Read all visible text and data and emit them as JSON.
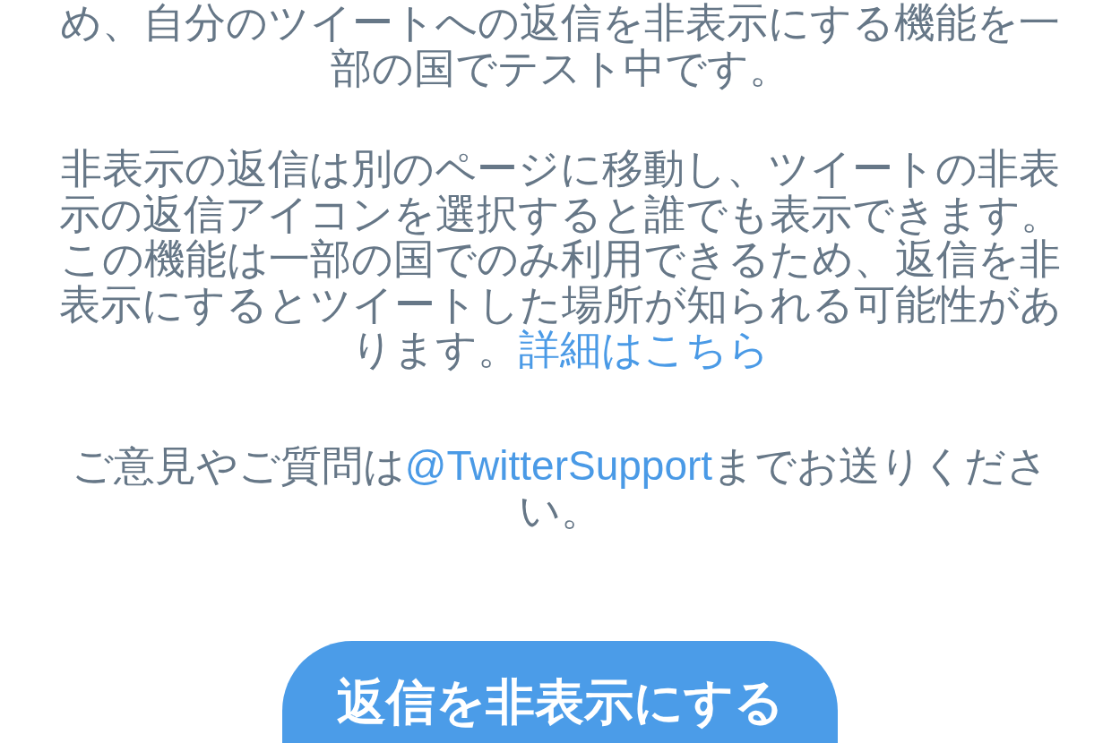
{
  "paragraphs": [
    {
      "parts": [
        {
          "kind": "text",
          "text": "め、自分のツイートへの返信を非表示にする機能を一部の国でテスト中です。"
        }
      ]
    },
    {
      "parts": [
        {
          "kind": "text",
          "text": "非表示の返信は別のページに移動し、ツイートの非表示の返信アイコンを選択すると誰でも表示できます。この機能は一部の国でのみ利用できるため、返信を非表示にするとツイートした場所が知られる可能性があります。"
        },
        {
          "kind": "link",
          "text": "詳細はこちら"
        }
      ]
    },
    {
      "parts": [
        {
          "kind": "text",
          "text": "ご意見やご質問は"
        },
        {
          "kind": "link",
          "text": "@TwitterSupport"
        },
        {
          "kind": "text",
          "text": "までお送りください。"
        }
      ]
    }
  ],
  "button": {
    "label": "返信を非表示にする"
  }
}
